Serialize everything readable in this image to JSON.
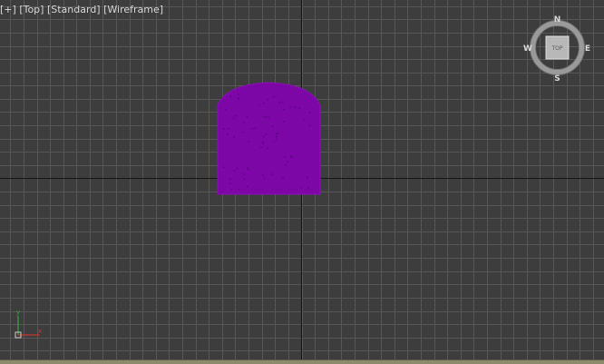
{
  "viewport_label": {
    "plus": "[+]",
    "view": "[Top]",
    "shading": "[Standard]",
    "mode": "[Wireframe]"
  },
  "viewcube": {
    "north": "N",
    "south": "S",
    "west": "W",
    "east": "E",
    "face": "TOP"
  },
  "axis_gizmo": {
    "x": "x",
    "y": "y"
  },
  "colors": {
    "background": "#3d3d3d",
    "grid": "#555555",
    "axis": "#1a1a1a",
    "object": "#7d06a6"
  }
}
